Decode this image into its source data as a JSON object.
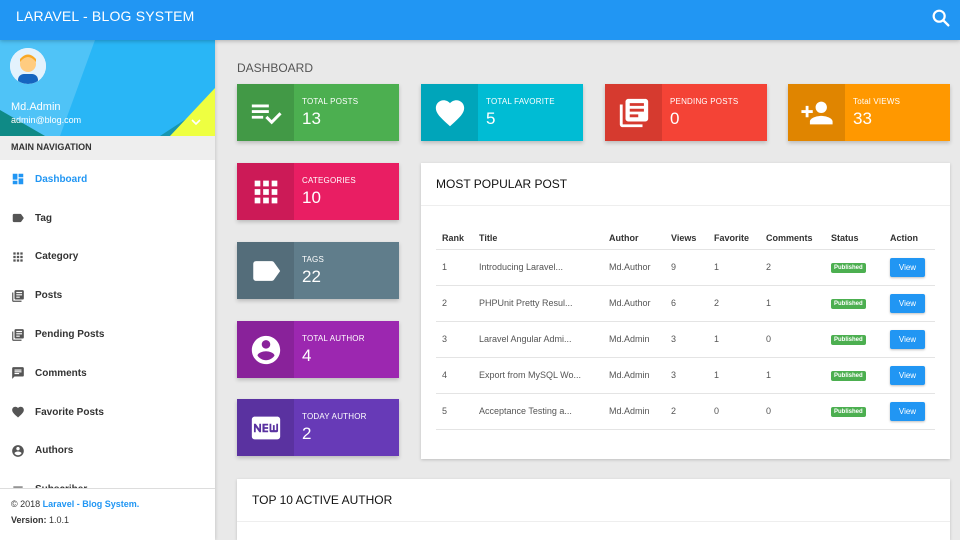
{
  "topbar": {
    "brand": "LARAVEL - BLOG SYSTEM",
    "search_icon": "search-icon"
  },
  "user": {
    "name": "Md.Admin",
    "email": "admin@blog.com"
  },
  "sidebar": {
    "nav_header": "MAIN NAVIGATION",
    "items": [
      {
        "label": "Dashboard",
        "icon": "dashboard-icon",
        "active": true
      },
      {
        "label": "Tag",
        "icon": "label-icon"
      },
      {
        "label": "Category",
        "icon": "apps-icon"
      },
      {
        "label": "Posts",
        "icon": "library-books-icon"
      },
      {
        "label": "Pending Posts",
        "icon": "library-books-icon"
      },
      {
        "label": "Comments",
        "icon": "comment-icon"
      },
      {
        "label": "Favorite Posts",
        "icon": "heart-icon"
      },
      {
        "label": "Authors",
        "icon": "account-circle-icon"
      },
      {
        "label": "Subscriber",
        "icon": "subscriber-icon"
      }
    ],
    "legal": {
      "copyright": "© 2018",
      "brand_link": "Laravel - Blog System.",
      "version_label": "Version:",
      "version": "1.0.1"
    }
  },
  "page_title": "DASHBOARD",
  "infoboxes": [
    {
      "label": "TOTAL POSTS",
      "value": "13",
      "color": "#4caf50",
      "icon": "playlist-check-icon"
    },
    {
      "label": "TOTAL FAVORITE",
      "value": "5",
      "color": "#00bcd4",
      "icon": "heart-icon"
    },
    {
      "label": "PENDING POSTS",
      "value": "0",
      "color": "#f44336",
      "icon": "library-books-icon"
    },
    {
      "label": "Total VIEWS",
      "value": "33",
      "color": "#ff9800",
      "icon": "person-add-icon"
    },
    {
      "label": "CATEGORIES",
      "value": "10",
      "color": "#e91e63",
      "icon": "apps-icon"
    },
    {
      "label": "TAGS",
      "value": "22",
      "color": "#607d8b",
      "icon": "label-icon"
    },
    {
      "label": "TOTAL AUTHOR",
      "value": "4",
      "color": "#9c27b0",
      "icon": "account-circle-icon"
    },
    {
      "label": "TODAY AUTHOR",
      "value": "2",
      "color": "#673ab7",
      "icon": "new-badge-icon"
    }
  ],
  "popular": {
    "title": "MOST POPULAR POST",
    "headers": [
      "Rank",
      "Title",
      "Author",
      "Views",
      "Favorite",
      "Comments",
      "Status",
      "Action"
    ],
    "rows": [
      {
        "rank": "1",
        "title": "Introducing Laravel...",
        "author": "Md.Author",
        "views": "9",
        "favorite": "1",
        "comments": "2",
        "status": "Published",
        "action": "View"
      },
      {
        "rank": "2",
        "title": "PHPUnit Pretty Resul...",
        "author": "Md.Author",
        "views": "6",
        "favorite": "2",
        "comments": "1",
        "status": "Published",
        "action": "View"
      },
      {
        "rank": "3",
        "title": "Laravel Angular Admi...",
        "author": "Md.Admin",
        "views": "3",
        "favorite": "1",
        "comments": "0",
        "status": "Published",
        "action": "View"
      },
      {
        "rank": "4",
        "title": "Export from MySQL Wo...",
        "author": "Md.Admin",
        "views": "3",
        "favorite": "1",
        "comments": "1",
        "status": "Published",
        "action": "View"
      },
      {
        "rank": "5",
        "title": "Acceptance Testing a...",
        "author": "Md.Admin",
        "views": "2",
        "favorite": "0",
        "comments": "0",
        "status": "Published",
        "action": "View"
      }
    ]
  },
  "active_authors": {
    "title": "TOP 10 ACTIVE AUTHOR"
  },
  "colors": {
    "primary": "#2196f3",
    "published": "#4caf50"
  }
}
